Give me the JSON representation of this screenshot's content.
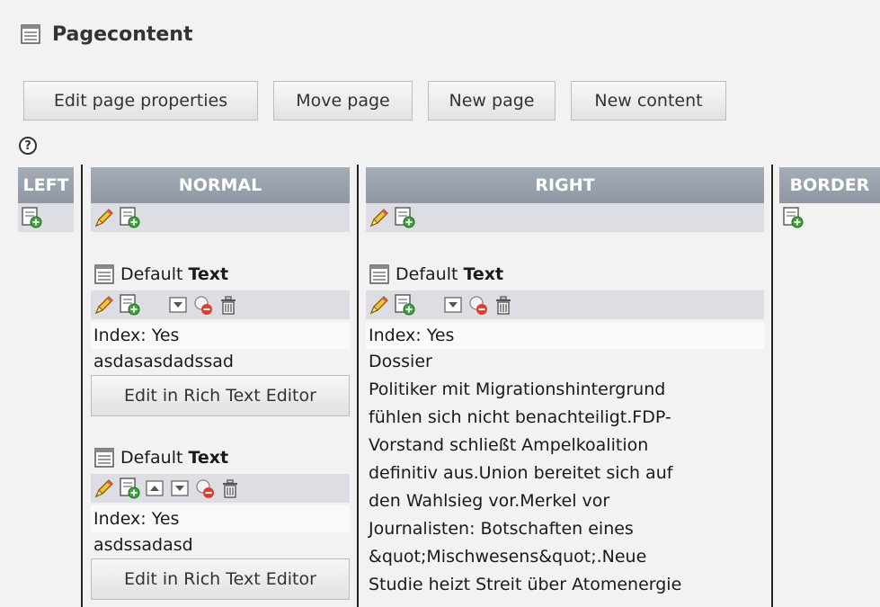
{
  "header": {
    "title": "Pagecontent"
  },
  "toolbar": {
    "edit_page_properties": "Edit page properties",
    "move_page": "Move page",
    "new_page": "New page",
    "new_content": "New content"
  },
  "help": {
    "label": "?"
  },
  "columns": {
    "left": "LEFT",
    "normal": "NORMAL",
    "right": "RIGHT",
    "border": "BORDER"
  },
  "normal_column": {
    "elements": [
      {
        "type_prefix": "Default ",
        "type_bold": "Text",
        "index": "Index: Yes",
        "body": "asdasasdadssad",
        "button": "Edit in Rich Text Editor"
      },
      {
        "type_prefix": "Default ",
        "type_bold": "Text",
        "index": "Index: Yes",
        "body": "asdssadasd",
        "button": "Edit in Rich Text Editor"
      }
    ]
  },
  "right_column": {
    "elements": [
      {
        "type_prefix": "Default ",
        "type_bold": "Text",
        "index": "Index: Yes",
        "lines": [
          "Dossier",
          "Politiker mit Migrationshintergrund",
          "fühlen sich nicht benachteiligt.FDP-",
          "Vorstand schließt Ampelkoalition",
          "definitiv aus.Union bereitet sich auf",
          "den Wahlsieg vor.Merkel vor",
          "Journalisten: Botschaften eines",
          "&quot;Mischwesens&quot;.Neue",
          "Studie heizt Streit über Atomenergie"
        ]
      }
    ]
  },
  "icons": [
    "page-icon",
    "pencil-icon",
    "new-record-icon",
    "move-up-icon",
    "move-down-icon",
    "hide-icon",
    "delete-icon",
    "help-icon"
  ]
}
